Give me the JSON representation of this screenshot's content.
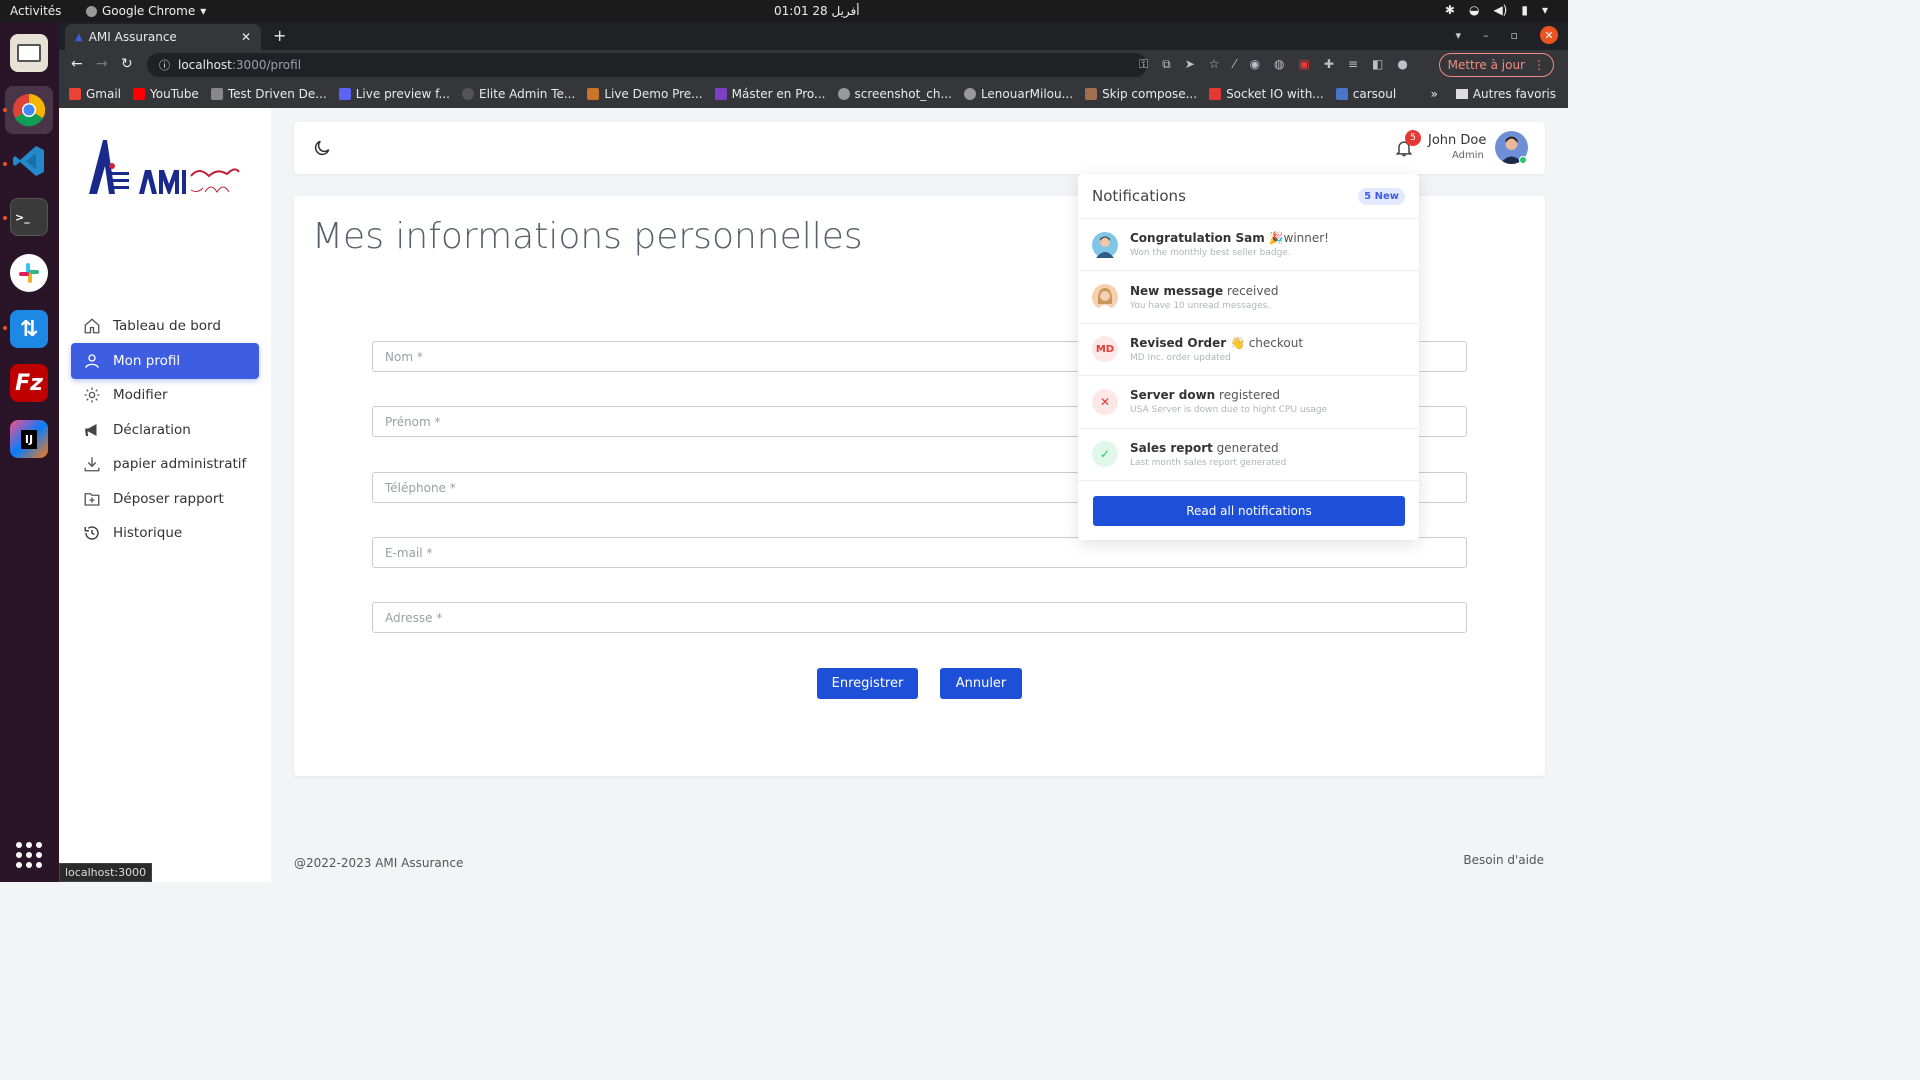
{
  "os": {
    "activities": "Activités",
    "app_name": "Google Chrome",
    "clock": "01:01 28 أفريل"
  },
  "browser": {
    "tab_title": "AMI Assurance",
    "url_host": "localhost",
    "url_path": ":3000/profil",
    "update_button": "Mettre à jour",
    "bookmarks": [
      "Gmail",
      "YouTube",
      "Test Driven De...",
      "Live preview f...",
      "Elite Admin Te...",
      "Live Demo Pre...",
      "Máster en Pro...",
      "screenshot_ch...",
      "LenouarMilou...",
      "Skip compose...",
      "Socket IO with...",
      "carsoul"
    ],
    "other_bookmarks": "Autres favoris",
    "status_url": "localhost:3000"
  },
  "sidebar": {
    "items": [
      {
        "label": "Tableau de bord",
        "icon": "home-icon"
      },
      {
        "label": "Mon profil",
        "icon": "user-icon",
        "active": true
      },
      {
        "label": "Modifier",
        "icon": "gear-icon"
      },
      {
        "label": "Déclaration",
        "icon": "megaphone-icon"
      },
      {
        "label": "papier administratif",
        "icon": "download-icon"
      },
      {
        "label": "Déposer rapport",
        "icon": "folder-plus-icon"
      },
      {
        "label": "Historique",
        "icon": "history-icon"
      }
    ]
  },
  "header": {
    "notification_count": "5",
    "user_name": "John Doe",
    "user_role": "Admin"
  },
  "main": {
    "title": "Mes informations personnelles",
    "fields": {
      "nom": "Nom *",
      "prenom": "Prénom *",
      "telephone": "Téléphone *",
      "email": "E-mail *",
      "adresse": "Adresse *"
    },
    "save_label": "Enregistrer",
    "cancel_label": "Annuler"
  },
  "notifications": {
    "title": "Notifications",
    "new_badge": "5 New",
    "items": [
      {
        "bold": "Congratulation Sam",
        "rest": " 🎉winner!",
        "sub": "Won the monthly best seller badge."
      },
      {
        "bold": "New message",
        "rest": " received",
        "sub": "You have 10 unread messages."
      },
      {
        "bold": "Revised Order",
        "rest": " 👋 checkout",
        "sub": "MD Inc. order updated",
        "initials": "MD"
      },
      {
        "bold": "Server down",
        "rest": " registered",
        "sub": "USA Server is down due to hight CPU usage"
      },
      {
        "bold": "Sales report",
        "rest": " generated",
        "sub": "Last month sales report generated"
      }
    ],
    "read_all": "Read all notifications"
  },
  "footer": {
    "copyright": "@2022-2023 AMI Assurance",
    "help": "Besoin d'aide"
  },
  "colors": {
    "primary": "#1e4fd8",
    "active_menu": "#3d5ee0",
    "danger": "#e53935",
    "success": "#28c76f"
  }
}
